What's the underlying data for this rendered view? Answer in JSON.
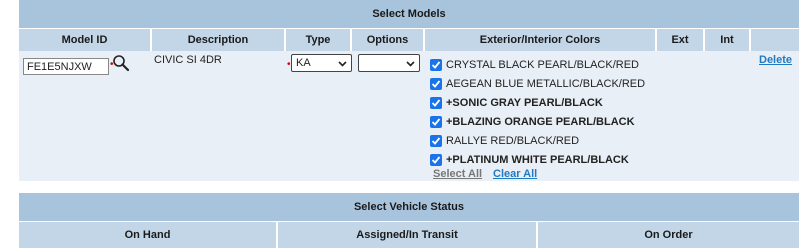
{
  "models": {
    "title": "Select Models",
    "columns": {
      "model_id": "Model ID",
      "description": "Description",
      "type": "Type",
      "options": "Options",
      "colors": "Exterior/Interior Colors",
      "ext": "Ext",
      "int": "Int"
    },
    "row": {
      "model_id_value": "FE1E5NJXW",
      "description": "CIVIC SI 4DR",
      "type_value": "KA",
      "options_value": "",
      "colors": [
        {
          "label": "CRYSTAL BLACK PEARL/BLACK/RED",
          "checked": true,
          "bold": false
        },
        {
          "label": "AEGEAN BLUE METALLIC/BLACK/RED",
          "checked": true,
          "bold": false
        },
        {
          "label": "+SONIC GRAY PEARL/BLACK",
          "checked": true,
          "bold": true
        },
        {
          "label": "+BLAZING ORANGE PEARL/BLACK",
          "checked": true,
          "bold": true
        },
        {
          "label": "RALLYE RED/BLACK/RED",
          "checked": true,
          "bold": false
        },
        {
          "label": "+PLATINUM WHITE PEARL/BLACK",
          "checked": true,
          "bold": true
        }
      ],
      "select_all": "Select All",
      "clear_all": "Clear All",
      "delete": "Delete"
    }
  },
  "status": {
    "title": "Select Vehicle Status",
    "columns": [
      "On Hand",
      "Assigned/In Transit",
      "On Order"
    ]
  },
  "colors": {
    "header_bg": "#a7c4dc",
    "subheader_bg": "#c2d6e8",
    "panel_bg": "#e9eff6",
    "checkbox": "#1a73e8",
    "link": "#1f7ac2"
  }
}
